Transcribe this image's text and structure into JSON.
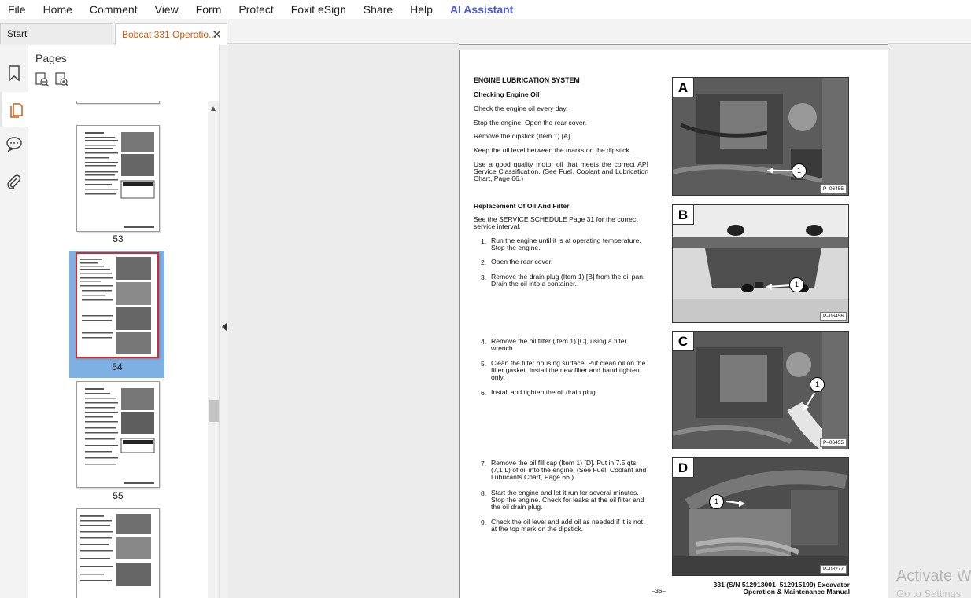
{
  "menu": [
    "File",
    "Home",
    "Comment",
    "View",
    "Form",
    "Protect",
    "Foxit eSign",
    "Share",
    "Help",
    "AI Assistant"
  ],
  "tabs": {
    "start": "Start",
    "doc": "Bobcat 331 Operatio...",
    "close": "✕"
  },
  "pages_panel": {
    "title": "Pages",
    "thumbs": [
      "53",
      "54",
      "55"
    ]
  },
  "page": {
    "heading": "ENGINE LUBRICATION SYSTEM",
    "sub1": "Checking Engine Oil",
    "p1": "Check the engine oil every day.",
    "p2": "Stop the engine. Open the rear cover.",
    "p3": "Remove the dipstick (Item 1) [A].",
    "p4": "Keep the oil level between the marks on the dipstick.",
    "p5": "Use a good quality motor oil that meets the correct API Service Classification. (See Fuel, Coolant and Lubrication Chart, Page 66.)",
    "sub2": "Replacement Of Oil And Filter",
    "p6": "See the SERVICE SCHEDULE Page 31 for the correct service interval.",
    "steps": [
      {
        "n": "1.",
        "t": "Run the engine until it is at operating temperature. Stop the engine."
      },
      {
        "n": "2.",
        "t": "Open the rear cover."
      },
      {
        "n": "3.",
        "t": "Remove the drain plug (Item 1) [B] from the oil pan. Drain the oil into a container."
      },
      {
        "n": "4.",
        "t": "Remove the oil filter (Item 1) [C], using a filter wrench."
      },
      {
        "n": "5.",
        "t": "Clean the filter housing surface. Put clean oil on the filter gasket. Install the new filter and hand tighten only."
      },
      {
        "n": "6.",
        "t": "Install and tighten the oil drain plug."
      },
      {
        "n": "7.",
        "t": "Remove the oil fill cap (Item 1) [D]. Put in 7.5 qts. (7,1 L) of oil into the engine. (See Fuel, Coolant and Lubricants Chart, Page 66.)"
      },
      {
        "n": "8.",
        "t": "Start the engine and let it run for several minutes. Stop the engine. Check for leaks at the oil filter and the oil drain plug."
      },
      {
        "n": "9.",
        "t": "Check the oil level and add oil as needed if it is not at the top mark on the dipstick."
      }
    ],
    "photos": [
      {
        "letter": "A",
        "code": "P–06455",
        "callout": "1"
      },
      {
        "letter": "B",
        "code": "P–06456",
        "callout": "1"
      },
      {
        "letter": "C",
        "code": "P–06455",
        "callout": "1"
      },
      {
        "letter": "D",
        "code": "P–08277",
        "callout": "1"
      }
    ],
    "footer_num": "–36–",
    "footer_title_1": "331 (S/N 512913001–512915199) Excavator",
    "footer_title_2": "Operation & Maintenance Manual"
  },
  "watermark": {
    "line1": "Activate W",
    "line2": "Go to Settings"
  }
}
